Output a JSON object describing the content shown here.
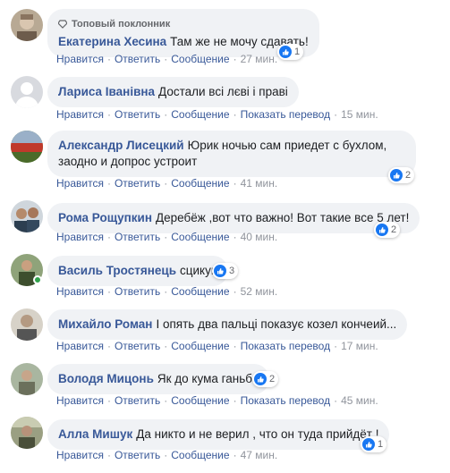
{
  "actions": {
    "like": "Нравится",
    "reply": "Ответить",
    "message": "Сообщение",
    "translate": "Показать перевод",
    "dot": "·"
  },
  "comments": [
    {
      "badge": "Топовый поклонник",
      "author": "Екатерина Хесина",
      "text": "Там же не мочу сдавать!",
      "reactions": "1",
      "time": "27 мин."
    },
    {
      "author": "Лариса Іванівна",
      "text": "Достали всі лєві і праві",
      "time": "15 мин."
    },
    {
      "author": "Александр Лисецкий",
      "text": "Юрик ночью сам приедет с бухлом, заодно и допрос устроит",
      "reactions": "2",
      "time": "41 мин."
    },
    {
      "author": "Рома Рощупкин",
      "text": "Деребёж ,вот что важно! Вот такие все 5 лет!",
      "reactions": "2",
      "time": "40 мин."
    },
    {
      "author": "Василь Тростянець",
      "text": "сцикун",
      "reactions": "3",
      "time": "52 мин."
    },
    {
      "author": "Михайло Роман",
      "text": "І опять два пальці показує козел кончеий...",
      "time": "17 мин."
    },
    {
      "author": "Володя Мицонь",
      "text": "Як до кума ганьба",
      "reactions": "2",
      "time": "45 мин."
    },
    {
      "author": "Алла Мишук",
      "text": "Да никто и не верил , что он туда прийдёт !",
      "reactions": "1",
      "time": "47 мин."
    }
  ],
  "colors": {
    "link": "#385898",
    "bubble": "#f0f2f5",
    "like": "#1877f2",
    "online": "#31a24c"
  }
}
